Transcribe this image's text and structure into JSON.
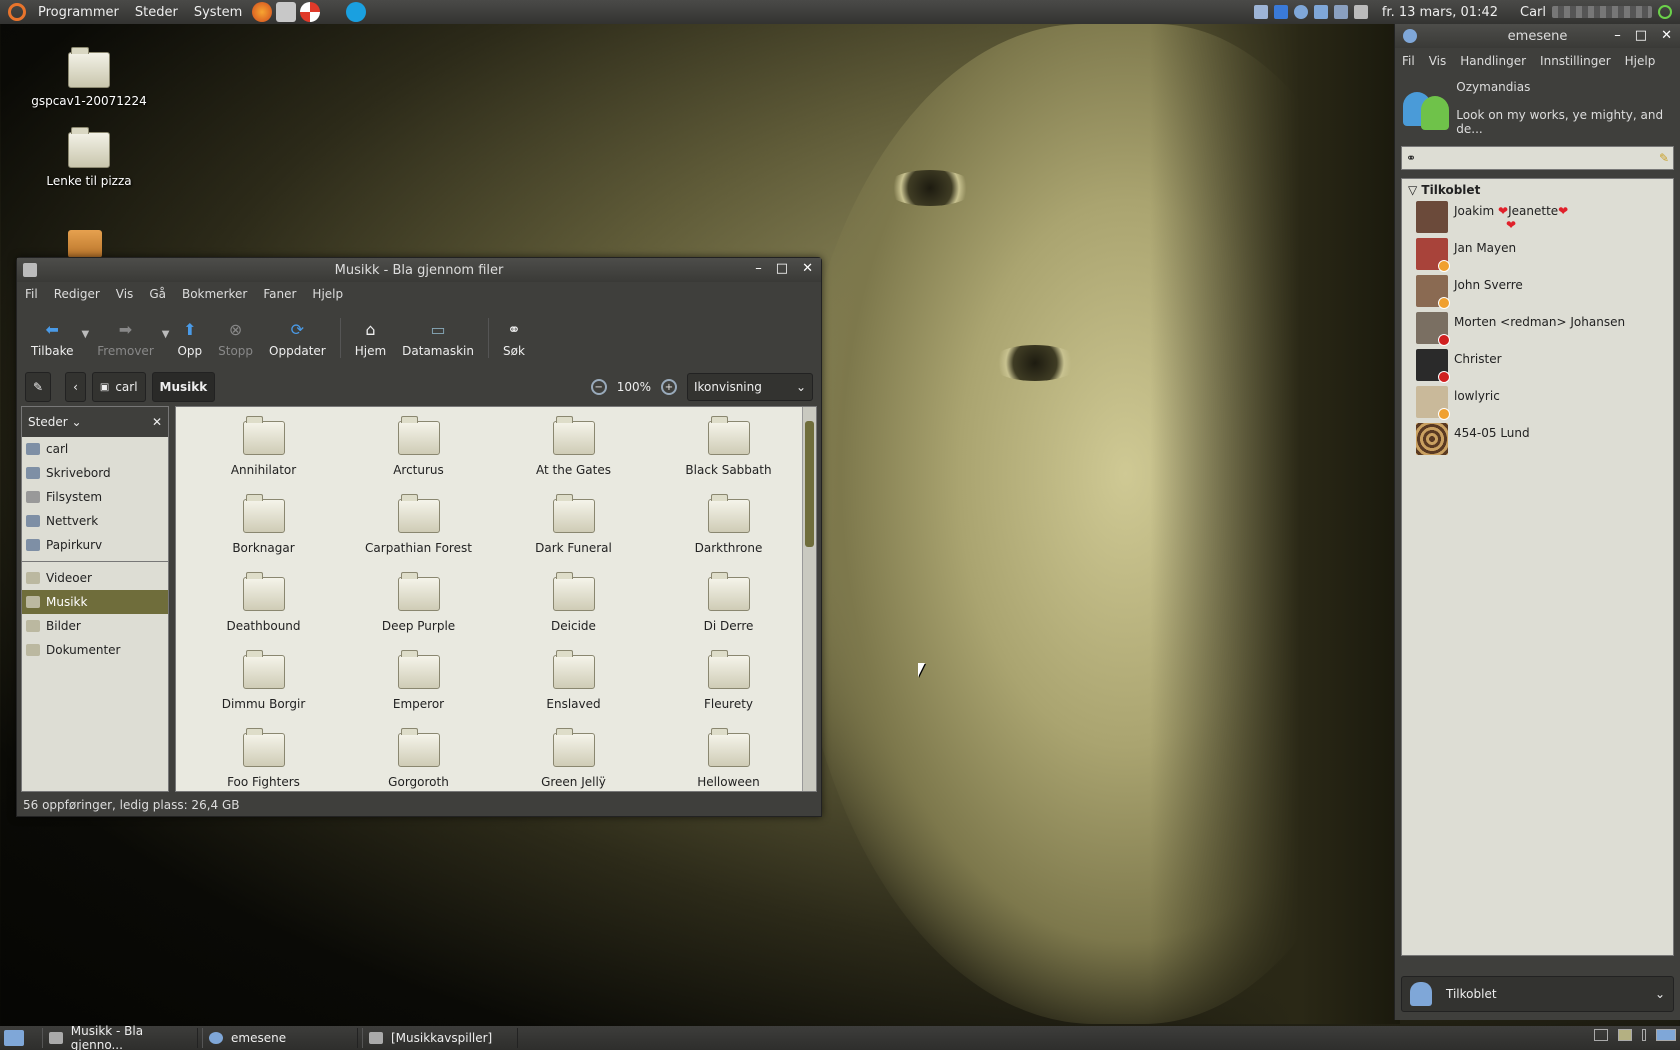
{
  "top_panel": {
    "menus": [
      "Programmer",
      "Steder",
      "System"
    ],
    "clock": "fr. 13 mars, 01:42",
    "user": "Carl"
  },
  "desktop_icons": [
    {
      "label": "gspcav1-20071224"
    },
    {
      "label": "Lenke til pizza"
    }
  ],
  "nautilus": {
    "title": "Musikk - Bla gjennom filer",
    "menu": [
      "Fil",
      "Rediger",
      "Vis",
      "Gå",
      "Bokmerker",
      "Faner",
      "Hjelp"
    ],
    "toolbar": {
      "back": "Tilbake",
      "forward": "Fremover",
      "up": "Opp",
      "stop": "Stopp",
      "reload": "Oppdater",
      "home": "Hjem",
      "computer": "Datamaskin",
      "search": "Søk"
    },
    "path": [
      "carl",
      "Musikk"
    ],
    "zoom": "100%",
    "view_mode": "Ikonvisning",
    "sidebar": {
      "header": "Steder",
      "places": [
        "carl",
        "Skrivebord",
        "Filsystem",
        "Nettverk",
        "Papirkurv"
      ],
      "bookmarks": [
        "Videoer",
        "Musikk",
        "Bilder",
        "Dokumenter"
      ],
      "selected": "Musikk"
    },
    "folders": [
      "Annihilator",
      "Arcturus",
      "At the Gates",
      "Black Sabbath",
      "Borknagar",
      "Carpathian Forest",
      "Dark Funeral",
      "Darkthrone",
      "Deathbound",
      "Deep Purple",
      "Deicide",
      "Di Derre",
      "Dimmu Borgir",
      "Emperor",
      "Enslaved",
      "Fleurety",
      "Foo Fighters",
      "Gorgoroth",
      "Green Jellÿ",
      "Helloween"
    ],
    "status": "56 oppføringer, ledig plass: 26,4 GB"
  },
  "emesene": {
    "title": "emesene",
    "menu": [
      "Fil",
      "Vis",
      "Handlinger",
      "Innstillinger",
      "Hjelp"
    ],
    "nick": "Ozymandias",
    "personal_message": "Look on my works, ye mighty, and de...",
    "group": "Tilkoblet",
    "contacts": [
      {
        "name": "Joakim",
        "name2": "Jeanette",
        "hearts": "❤",
        "avatar_color": "#6b4a3a",
        "status_color": ""
      },
      {
        "name": "Jan Mayen",
        "avatar_color": "#a8433a",
        "status_color": "#f0a030"
      },
      {
        "name": "John Sverre",
        "avatar_color": "#8a6a52",
        "status_color": "#f0a030"
      },
      {
        "name": "Morten <redman> Johansen",
        "avatar_color": "#7a6f62",
        "status_color": "#d02020"
      },
      {
        "name": "Christer",
        "avatar_color": "#2a2a2a",
        "status_color": "#d02020"
      },
      {
        "name": "lowlyric",
        "avatar_color": "#c9b99a",
        "status_color": "#f0a030"
      },
      {
        "name": "454-05 Lund",
        "avatar_color": "#5a3a22",
        "status_color": ""
      }
    ],
    "status": "Tilkoblet"
  },
  "taskbar": {
    "tasks": [
      "Musikk - Bla gjenno...",
      "emesene",
      "[Musikkavspiller]"
    ]
  }
}
